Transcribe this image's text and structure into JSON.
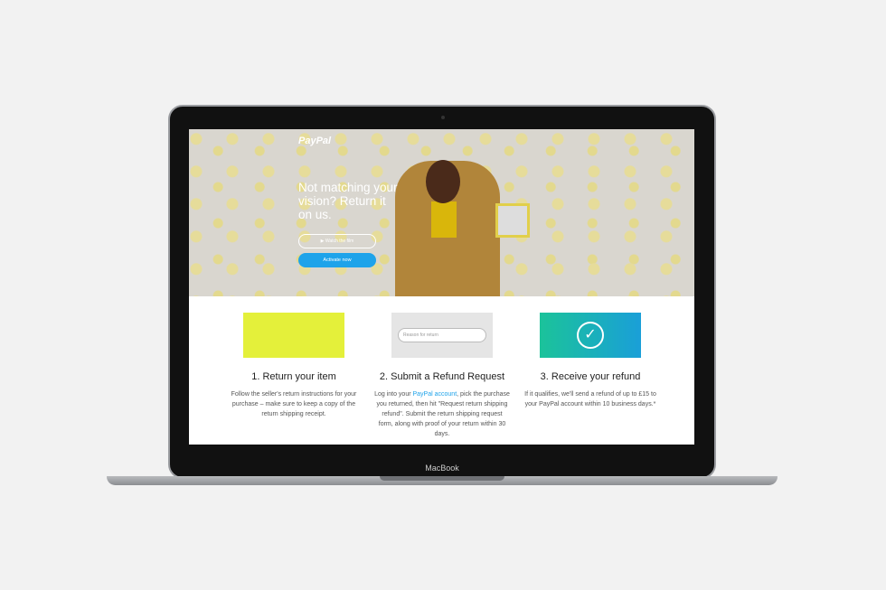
{
  "device": {
    "brand": "MacBook"
  },
  "hero": {
    "logo": "PayPal",
    "headline": "Not matching your vision? Return it on us.",
    "watch_label": "▶ Watch the film",
    "activate_label": "Activate now"
  },
  "steps": [
    {
      "title": "1. Return your item",
      "text": "Follow the seller's return instructions for your purchase – make sure to keep a copy of the return shipping receipt."
    },
    {
      "title": "2. Submit a Refund Request",
      "text_before": "Log into your ",
      "link": "PayPal account",
      "text_after": ", pick the purchase you returned, then hit \"Request return shipping refund\". Submit the return shipping request form, along with proof of your return within 30 days.",
      "select_placeholder": "Reason for return"
    },
    {
      "title": "3. Receive your refund",
      "text": "If it qualifies, we'll send a refund of up to £15 to your PayPal account within 10 business days.*"
    }
  ],
  "colors": {
    "accent": "#1ea3ea"
  }
}
